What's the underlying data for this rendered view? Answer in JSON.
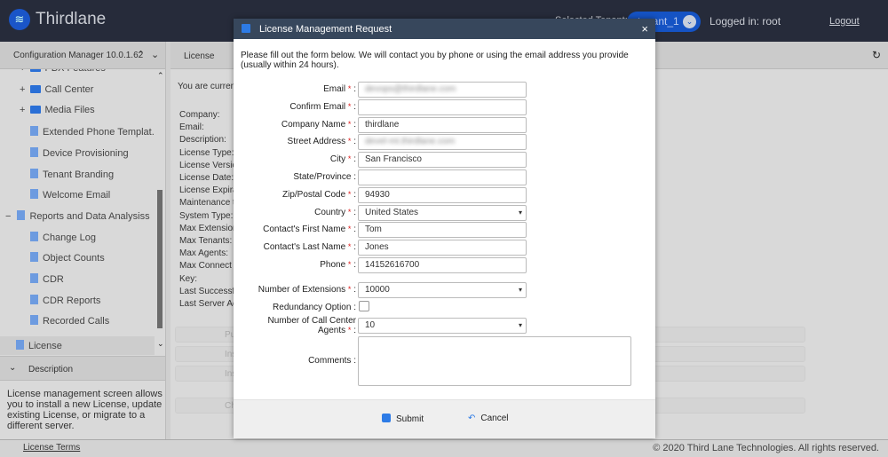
{
  "header": {
    "brand": "Thirdlane",
    "selected_tenant_label": "Selected Tenant:",
    "tenant": "tenant_1",
    "logged_in": "Logged in: root",
    "logout": "Logout"
  },
  "sidebar": {
    "title": "Configuration Manager 10.0.1.62",
    "items": [
      {
        "label": "PBX Features",
        "type": "folder",
        "expander": "+"
      },
      {
        "label": "Call Center",
        "type": "folder",
        "expander": "+"
      },
      {
        "label": "Media Files",
        "type": "folder",
        "expander": "+"
      },
      {
        "label": "Extended Phone Templat...",
        "type": "doc"
      },
      {
        "label": "Device Provisioning",
        "type": "doc"
      },
      {
        "label": "Tenant Branding",
        "type": "doc"
      },
      {
        "label": "Welcome Email",
        "type": "doc"
      },
      {
        "label": "Reports and Data Analysiss",
        "type": "docs",
        "expander": "−"
      },
      {
        "label": "Change Log",
        "type": "doc"
      },
      {
        "label": "Object Counts",
        "type": "doc"
      },
      {
        "label": "CDR",
        "type": "doc"
      },
      {
        "label": "CDR Reports",
        "type": "doc"
      },
      {
        "label": "Recorded Calls",
        "type": "doc"
      }
    ],
    "selected": "License",
    "description_title": "Description",
    "description": "License management screen allows you to install a new License, update existing License, or migrate to a different server."
  },
  "main": {
    "tab": "License",
    "current": "You are current",
    "fields": [
      "Company:",
      "Email:",
      "Description:",
      "License Type:",
      "License Versic",
      "License Date:",
      "License Expira",
      "Maintenance t",
      "System Type:",
      "Max Extensior",
      "Max Tenants:",
      "Max Agents:",
      "Max Connect",
      "Key:",
      "Last Successfi",
      "Last Server Ac"
    ],
    "buttons": [
      "Pur",
      "Ins",
      "Ins",
      "Ch"
    ]
  },
  "footer": {
    "terms": "License Terms",
    "copyright": "© 2020 Third Lane Technologies. All rights reserved."
  },
  "modal": {
    "title": "License Management Request",
    "close": "×",
    "intro": "Please fill out the form below. We will contact you by phone or using the email address you provide (usually within 24 hours).",
    "fields": [
      {
        "label": "Email",
        "required": true,
        "value": "devops@thirdlane.com",
        "blurred": true
      },
      {
        "label": "Confirm Email",
        "required": true,
        "value": ""
      },
      {
        "label": "Company Name",
        "required": true,
        "value": "thirdlane"
      },
      {
        "label": "Street Address",
        "required": true,
        "value": "devel-mt.thirdlane.com",
        "blurred": true
      },
      {
        "label": "City",
        "required": true,
        "value": "San Francisco"
      },
      {
        "label": "State/Province",
        "required": false,
        "value": ""
      },
      {
        "label": "Zip/Postal Code",
        "required": true,
        "value": "94930"
      },
      {
        "label": "Country",
        "required": true,
        "value": "United States",
        "select": true
      },
      {
        "label": "Contact's First Name",
        "required": true,
        "value": "Tom"
      },
      {
        "label": "Contact's Last Name",
        "required": true,
        "value": "Jones"
      },
      {
        "label": "Phone",
        "required": true,
        "value": "14152616700"
      }
    ],
    "extensions": {
      "label": "Number of Extensions",
      "value": "10000"
    },
    "redundancy": {
      "label": "Redundancy Option",
      "checked": false
    },
    "agents": {
      "label1": "Number of Call Center",
      "label2": "Agents",
      "value": "10"
    },
    "comments": {
      "label": "Comments",
      "value": ""
    },
    "submit": "Submit",
    "cancel": "Cancel"
  }
}
